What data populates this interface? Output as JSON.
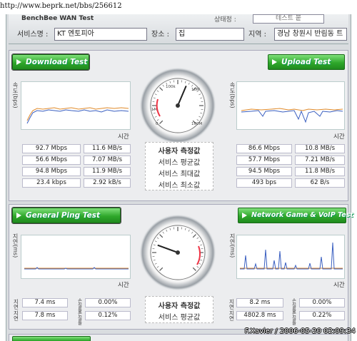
{
  "browser": {
    "url": "http://www.beprk.net/bbs/256612"
  },
  "header": {
    "title": "BenchBee WAN Test",
    "status_label": "상태정 :",
    "status_value": "테스트 붙",
    "fields": [
      {
        "label": "서비스명 :",
        "value": "KT 엔토피아"
      },
      {
        "label": "장소 :",
        "value": "집"
      },
      {
        "label": "지역 :",
        "value": "경남 창원시 반림동 트"
      }
    ]
  },
  "speed": {
    "download_button": "Download Test",
    "upload_button": "Upload Test",
    "gauge": {
      "label_top": "100k",
      "labels": [
        "0",
        "1M",
        "2M",
        "10M",
        "100M"
      ],
      "value_angle": 23
    },
    "download_graph": {
      "ylabel": "속도(bps)",
      "xlabel": "시간"
    },
    "upload_graph": {
      "ylabel": "속도(bps)",
      "xlabel": "시간"
    },
    "center_labels": [
      "사용자 측정값",
      "서비스 평균값",
      "서비스 최대값",
      "서비스 최소값"
    ],
    "download_rows": [
      [
        "92.7 Mbps",
        "11.6 MB/s"
      ],
      [
        "56.6 Mbps",
        "7.07 MB/s"
      ],
      [
        "94.8 Mbps",
        "11.9 MB/s"
      ],
      [
        "23.4 kbps",
        "2.92 kB/s"
      ]
    ],
    "upload_rows": [
      [
        "86.6 Mbps",
        "10.8 MB/s"
      ],
      [
        "57.7 Mbps",
        "7.21 MB/s"
      ],
      [
        "94.5 Mbps",
        "11.8 MB/s"
      ],
      [
        "493 bps",
        "62 B/s"
      ]
    ]
  },
  "ping": {
    "ping_button": "General Ping Test",
    "game_button": "Network Game & VoIP Test",
    "ping_graph": {
      "ylabel": "지연(ms)",
      "xlabel": "시간"
    },
    "game_graph": {
      "ylabel": "지연(ms)",
      "xlabel": "시간"
    },
    "center_labels": [
      "사용자 측정값",
      "서비스 평균값"
    ],
    "row_label_delay": "지연",
    "row_label_loss": "손실률",
    "ping_rows": [
      [
        "7.4 ms",
        "0.00%"
      ],
      [
        "7.8 ms",
        "0.12%"
      ]
    ],
    "game_rows": [
      [
        "8.2 ms",
        "0.00%"
      ],
      [
        "4802.8 ms",
        "0.22%"
      ]
    ],
    "gauge": {
      "value_angle": -70
    }
  },
  "signature": "F.Xavier / 2006-05-20 02:09:34",
  "colors": {
    "button_green": "#2fa82b",
    "series_orange": "#e08a2a",
    "series_blue": "#3a5fc0"
  }
}
